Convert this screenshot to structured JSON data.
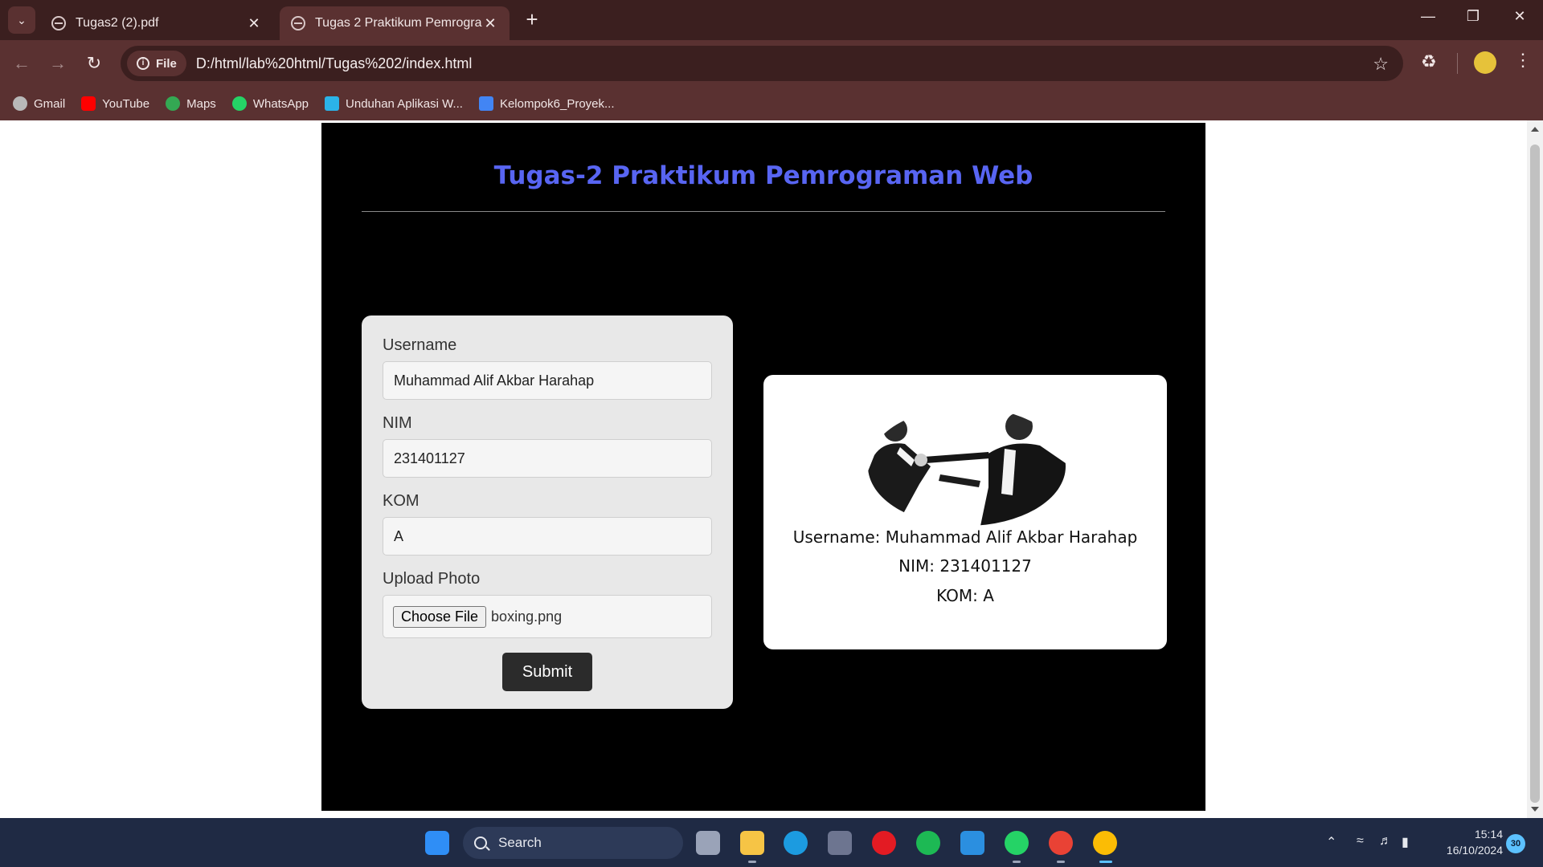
{
  "browser": {
    "tabs": [
      {
        "title": "Tugas2 (2).pdf",
        "active": false
      },
      {
        "title": "Tugas 2 Praktikum Pemrograma",
        "active": true
      }
    ],
    "new_tab": "+",
    "url_chip": "File",
    "url": "D:/html/lab%20html/Tugas%202/index.html",
    "bookmarks": [
      "Gmail",
      "YouTube",
      "Maps",
      "WhatsApp",
      "Unduhan Aplikasi W...",
      "Kelompok6_Proyek..."
    ]
  },
  "page": {
    "title": "Tugas-2 Praktikum Pemrograman Web",
    "title_color": "#5865f2",
    "form": {
      "username_label": "Username",
      "username_value": "Muhammad Alif Akbar Harahap",
      "nim_label": "NIM",
      "nim_value": "231401127",
      "kom_label": "KOM",
      "kom_value": "A",
      "photo_label": "Upload Photo",
      "choose_file": "Choose File",
      "file_name": "boxing.png",
      "submit": "Submit"
    },
    "result": {
      "username_line": "Username: Muhammad Alif Akbar Harahap",
      "nim_line": "NIM: 231401127",
      "kom_line": "KOM: A"
    }
  },
  "taskbar": {
    "search_label": "Search",
    "time": "15:14",
    "date": "16/10/2024",
    "notifications": "30"
  }
}
